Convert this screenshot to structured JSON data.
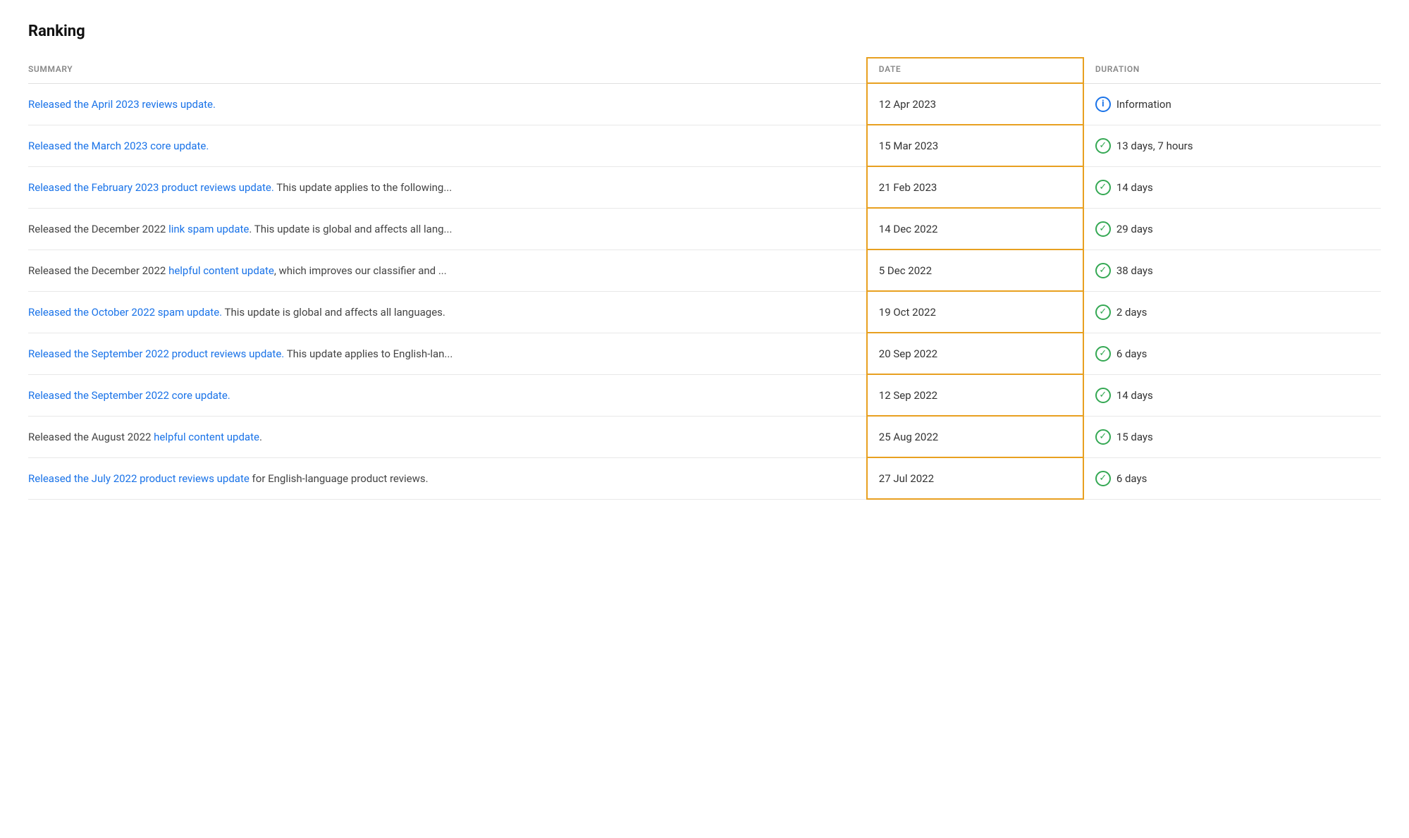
{
  "page": {
    "title": "Ranking"
  },
  "table": {
    "columns": [
      {
        "key": "summary",
        "label": "SUMMARY"
      },
      {
        "key": "date",
        "label": "DATE"
      },
      {
        "key": "duration",
        "label": "DURATION"
      }
    ],
    "rows": [
      {
        "id": 1,
        "summary_parts": [
          {
            "text": "Released the April 2023 reviews update.",
            "type": "link"
          }
        ],
        "date": "12 Apr 2023",
        "duration": "Information",
        "duration_icon": "info"
      },
      {
        "id": 2,
        "summary_parts": [
          {
            "text": "Released the March 2023 core update.",
            "type": "link"
          }
        ],
        "date": "15 Mar 2023",
        "duration": "13 days, 7 hours",
        "duration_icon": "check"
      },
      {
        "id": 3,
        "summary_parts": [
          {
            "text": "Released the February 2023 product reviews update.",
            "type": "link"
          },
          {
            "text": " This update applies to the following...",
            "type": "text"
          }
        ],
        "date": "21 Feb 2023",
        "duration": "14 days",
        "duration_icon": "check"
      },
      {
        "id": 4,
        "summary_parts": [
          {
            "text": "Released",
            "type": "text"
          },
          {
            "text": " the December 2022 ",
            "type": "text"
          },
          {
            "text": "link spam update",
            "type": "link"
          },
          {
            "text": ". This update is global and affects all lang...",
            "type": "text"
          }
        ],
        "date": "14 Dec 2022",
        "duration": "29 days",
        "duration_icon": "check"
      },
      {
        "id": 5,
        "summary_parts": [
          {
            "text": "Released the December 2022 ",
            "type": "text"
          },
          {
            "text": "helpful content update",
            "type": "link"
          },
          {
            "text": ", which improves our classifier and ...",
            "type": "text"
          }
        ],
        "date": "5 Dec 2022",
        "duration": "38 days",
        "duration_icon": "check"
      },
      {
        "id": 6,
        "summary_parts": [
          {
            "text": "Released the October 2022 spam update.",
            "type": "link"
          },
          {
            "text": " This update is global and affects all languages.",
            "type": "text"
          }
        ],
        "date": "19 Oct 2022",
        "duration": "2 days",
        "duration_icon": "check"
      },
      {
        "id": 7,
        "summary_parts": [
          {
            "text": "Released the September 2022 product reviews update.",
            "type": "link"
          },
          {
            "text": " This update applies to English-lan...",
            "type": "text"
          }
        ],
        "date": "20 Sep 2022",
        "duration": "6 days",
        "duration_icon": "check"
      },
      {
        "id": 8,
        "summary_parts": [
          {
            "text": "Released the September 2022 core update.",
            "type": "link"
          }
        ],
        "date": "12 Sep 2022",
        "duration": "14 days",
        "duration_icon": "check"
      },
      {
        "id": 9,
        "summary_parts": [
          {
            "text": "Released",
            "type": "text"
          },
          {
            "text": " the August 2022 ",
            "type": "text"
          },
          {
            "text": "helpful content update",
            "type": "link"
          },
          {
            "text": ".",
            "type": "text"
          }
        ],
        "date": "25 Aug 2022",
        "duration": "15 days",
        "duration_icon": "check"
      },
      {
        "id": 10,
        "summary_parts": [
          {
            "text": "Released the July 2022 product reviews update",
            "type": "link"
          },
          {
            "text": " for English-language product reviews.",
            "type": "text"
          }
        ],
        "date": "27 Jul 2022",
        "duration": "6 days",
        "duration_icon": "check"
      }
    ]
  }
}
